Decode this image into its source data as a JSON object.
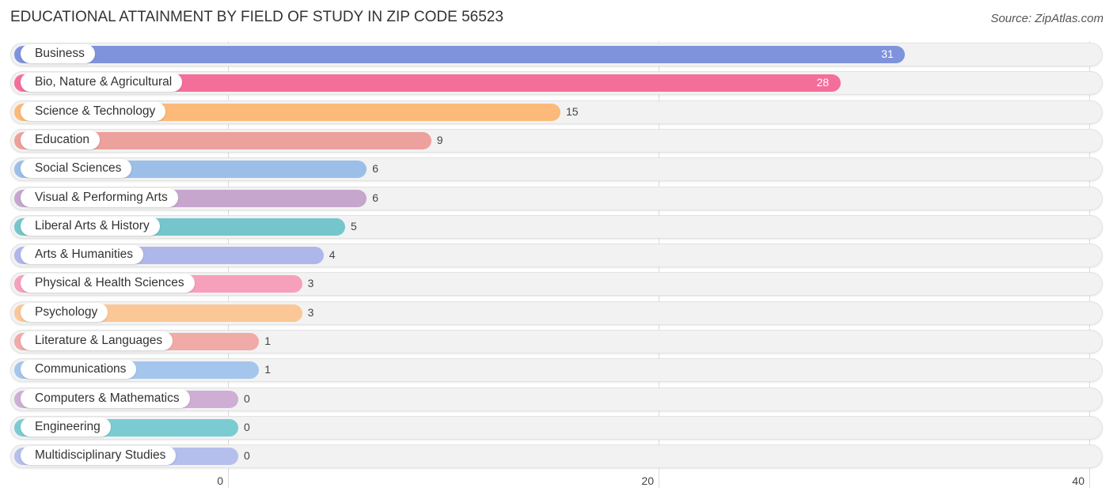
{
  "chart_data": {
    "type": "bar",
    "orientation": "horizontal",
    "title": "EDUCATIONAL ATTAINMENT BY FIELD OF STUDY IN ZIP CODE 56523",
    "source": "Source: ZipAtlas.com",
    "xlabel": "",
    "ylabel": "",
    "xlim": [
      0,
      40
    ],
    "xticks": [
      "0",
      "20",
      "40"
    ],
    "grid": true,
    "categories": [
      "Business",
      "Bio, Nature & Agricultural",
      "Science & Technology",
      "Education",
      "Social Sciences",
      "Visual & Performing Arts",
      "Liberal Arts & History",
      "Arts & Humanities",
      "Physical & Health Sciences",
      "Psychology",
      "Literature & Languages",
      "Communications",
      "Computers & Mathematics",
      "Engineering",
      "Multidisciplinary Studies"
    ],
    "values": [
      31,
      28,
      15,
      9,
      6,
      6,
      5,
      4,
      3,
      3,
      1,
      1,
      0,
      0,
      0
    ],
    "value_labels": [
      "31",
      "28",
      "15",
      "9",
      "6",
      "6",
      "5",
      "4",
      "3",
      "3",
      "1",
      "1",
      "0",
      "0",
      "0"
    ],
    "colors": [
      "#7f93dd",
      "#f46e9a",
      "#fbba7a",
      "#eda19c",
      "#9cbfe8",
      "#c6a6cd",
      "#74c6cc",
      "#aeb6ea",
      "#f6a0bb",
      "#fbc796",
      "#f0aaa8",
      "#a5c6ec",
      "#cfaed6",
      "#7accd2",
      "#b5bfec"
    ]
  }
}
